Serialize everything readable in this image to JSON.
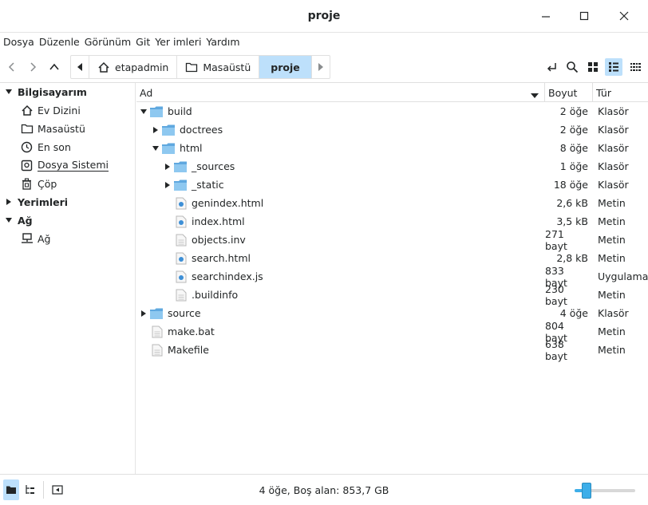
{
  "window": {
    "title": "proje"
  },
  "menu": [
    "Dosya",
    "Düzenle",
    "Görünüm",
    "Git",
    "Yer imleri",
    "Yardım"
  ],
  "breadcrumb": [
    "etapadmin",
    "Masaüstü",
    "proje"
  ],
  "sidebar": {
    "sections": [
      {
        "label": "Bilgisayarım",
        "expanded": true
      },
      {
        "label": "Yerimleri",
        "expanded": false
      },
      {
        "label": "Ağ",
        "expanded": true
      }
    ],
    "items": [
      {
        "label": "Ev Dizini",
        "icon": "home-icon"
      },
      {
        "label": "Masaüstü",
        "icon": "folder-icon"
      },
      {
        "label": "En son",
        "icon": "clock-icon"
      },
      {
        "label": "Dosya Sistemi",
        "icon": "drive-icon"
      },
      {
        "label": "Çöp",
        "icon": "trash-icon"
      },
      {
        "label": "Ağ",
        "icon": "network-icon"
      }
    ]
  },
  "columns": {
    "name": "Ad",
    "size": "Boyut",
    "type": "Tür"
  },
  "rows": [
    {
      "name": "build",
      "size": "2 öğe",
      "type": "Klasör",
      "icon": "folder",
      "depth": 0,
      "expander": "open"
    },
    {
      "name": "doctrees",
      "size": "2 öğe",
      "type": "Klasör",
      "icon": "folder",
      "depth": 1,
      "expander": "closed"
    },
    {
      "name": "html",
      "size": "8 öğe",
      "type": "Klasör",
      "icon": "folder",
      "depth": 1,
      "expander": "open"
    },
    {
      "name": "_sources",
      "size": "1 öğe",
      "type": "Klasör",
      "icon": "folder",
      "depth": 2,
      "expander": "closed"
    },
    {
      "name": "_static",
      "size": "18 öğe",
      "type": "Klasör",
      "icon": "folder",
      "depth": 2,
      "expander": "closed"
    },
    {
      "name": "genindex.html",
      "size": "2,6 kB",
      "type": "Metin",
      "icon": "html",
      "depth": 2,
      "expander": "none"
    },
    {
      "name": "index.html",
      "size": "3,5 kB",
      "type": "Metin",
      "icon": "html",
      "depth": 2,
      "expander": "none"
    },
    {
      "name": "objects.inv",
      "size": "271 bayt",
      "type": "Metin",
      "icon": "text",
      "depth": 2,
      "expander": "none"
    },
    {
      "name": "search.html",
      "size": "2,8 kB",
      "type": "Metin",
      "icon": "html",
      "depth": 2,
      "expander": "none"
    },
    {
      "name": "searchindex.js",
      "size": "833 bayt",
      "type": "Uygulama",
      "icon": "js",
      "depth": 2,
      "expander": "none"
    },
    {
      "name": ".buildinfo",
      "size": "230 bayt",
      "type": "Metin",
      "icon": "text",
      "depth": 2,
      "expander": "none"
    },
    {
      "name": "source",
      "size": "4 öğe",
      "type": "Klasör",
      "icon": "folder",
      "depth": 0,
      "expander": "closed"
    },
    {
      "name": "make.bat",
      "size": "804 bayt",
      "type": "Metin",
      "icon": "text",
      "depth": 0,
      "expander": "none"
    },
    {
      "name": "Makefile",
      "size": "638 bayt",
      "type": "Metin",
      "icon": "text",
      "depth": 0,
      "expander": "none"
    }
  ],
  "status": {
    "text": "4 öğe, Boş alan: 853,7 GB",
    "zoom_fraction": 0.2
  },
  "colors": {
    "accent": "#3daee9",
    "selection": "#bde0fb",
    "folder": "#8ec8f0"
  }
}
